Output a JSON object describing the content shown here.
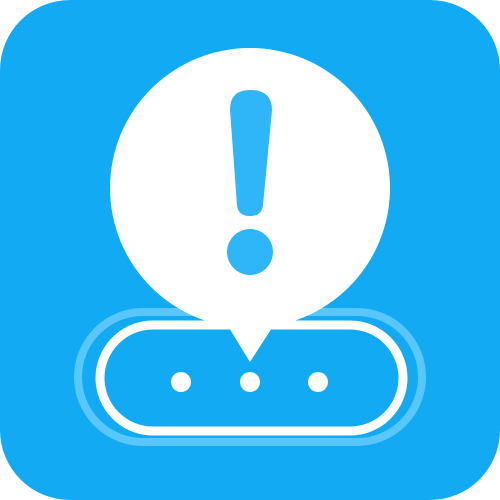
{
  "app_icon": {
    "icon_name": "notification-alert-app-icon",
    "background_color": "#12ABF3",
    "bubble_color": "#FFFFFF",
    "exclamation_color": "#2EB6F8",
    "pill_outline_color": "#FFFFFF",
    "pill_glow_color": "#7FD5FF",
    "dots_count": 3
  }
}
